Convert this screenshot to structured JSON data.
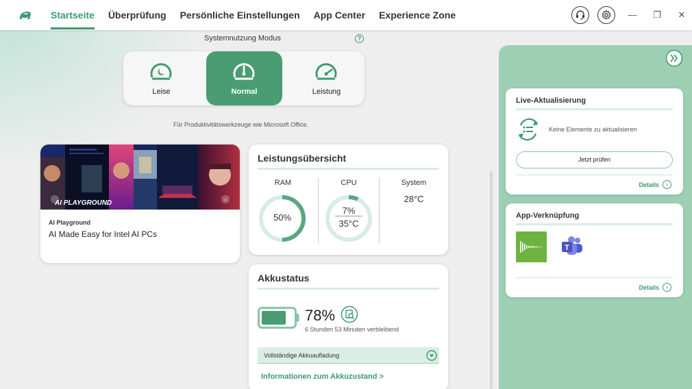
{
  "nav": {
    "items": [
      {
        "label": "Startseite",
        "active": true
      },
      {
        "label": "Überprüfung",
        "active": false
      },
      {
        "label": "Persönliche Einstellungen",
        "active": false
      },
      {
        "label": "App Center",
        "active": false
      },
      {
        "label": "Experience Zone",
        "active": false
      }
    ],
    "icons": [
      "headset-icon",
      "gear-icon"
    ],
    "window_controls": [
      "minimize",
      "restore",
      "close"
    ]
  },
  "mode": {
    "title": "Systemnutzung Modus",
    "options": [
      {
        "label": "Leise",
        "active": false
      },
      {
        "label": "Normal",
        "active": true
      },
      {
        "label": "Leistung",
        "active": false
      }
    ],
    "description": "Für Produktivitätswerkzeuge wie Microsoft Office."
  },
  "ai_card": {
    "image_badge": "AI PLAYGROUND",
    "subtitle": "AI Playground",
    "headline": "AI Made Easy for Intel AI PCs"
  },
  "performance": {
    "title": "Leistungsübersicht",
    "ram": {
      "label": "RAM",
      "value": "50%",
      "fraction": 0.5
    },
    "cpu": {
      "label": "CPU",
      "value": "7%",
      "temp": "35°C",
      "fraction": 0.07
    },
    "system": {
      "label": "System",
      "temp": "28°C"
    }
  },
  "battery": {
    "title": "Akkustatus",
    "percent": "78%",
    "level": 0.78,
    "remaining": "6 Stunden 53 Minuten verbleibend",
    "mode_select": "Vollständige Akkuaufladung",
    "info_link": "Informationen zum Akkuzustand >"
  },
  "live_update": {
    "title": "Live-Aktualisierung",
    "status": "Keine Elemente zu aktualisieren",
    "button": "Jetzt prüfen",
    "details": "Details"
  },
  "app_link": {
    "title": "App-Verknüpfung",
    "apps": [
      "audio-app-icon",
      "teams-icon"
    ],
    "details": "Details"
  },
  "colors": {
    "accent": "#3b9a6c",
    "accent_active": "#4a9d72",
    "panel": "#9dcfb5"
  }
}
